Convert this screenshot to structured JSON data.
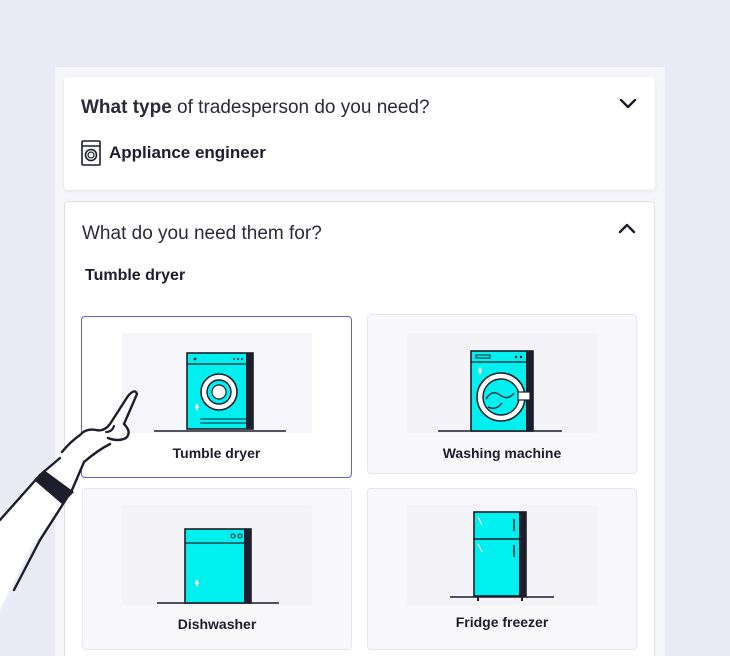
{
  "question1": {
    "bold": "What type",
    "rest": " of tradesperson do you need?",
    "selected_label": "Appliance engineer",
    "selected_icon": "washing-machine-icon"
  },
  "question2": {
    "text": "What do you need them for?",
    "selected_value": "Tumble dryer"
  },
  "options": [
    {
      "label": "Tumble dryer",
      "icon": "tumble-dryer-icon",
      "selected": true
    },
    {
      "label": "Washing machine",
      "icon": "washing-machine-icon",
      "selected": false
    },
    {
      "label": "Dishwasher",
      "icon": "dishwasher-icon",
      "selected": false
    },
    {
      "label": "Fridge freezer",
      "icon": "fridge-freezer-icon",
      "selected": false
    }
  ],
  "colors": {
    "appliance": "#00f0f0",
    "selected_border": "#5a66d6",
    "background": "#ebebf7"
  }
}
